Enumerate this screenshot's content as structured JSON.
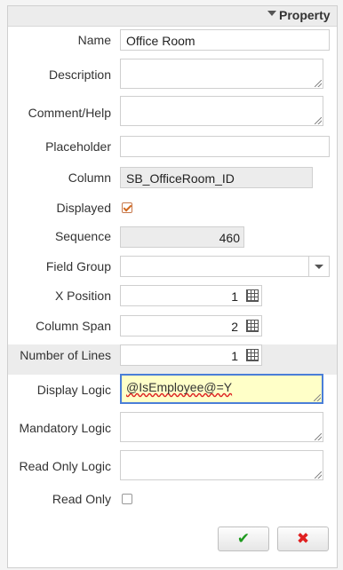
{
  "header": {
    "title": "Property"
  },
  "fields": {
    "name": {
      "label": "Name",
      "value": "Office Room"
    },
    "description": {
      "label": "Description",
      "value": ""
    },
    "comment_help": {
      "label": "Comment/Help",
      "value": ""
    },
    "placeholder": {
      "label": "Placeholder",
      "value": ""
    },
    "column": {
      "label": "Column",
      "value": "SB_OfficeRoom_ID"
    },
    "displayed": {
      "label": "Displayed",
      "checked": true
    },
    "sequence": {
      "label": "Sequence",
      "value": "460"
    },
    "field_group": {
      "label": "Field Group",
      "value": ""
    },
    "x_position": {
      "label": "X Position",
      "value": "1"
    },
    "column_span": {
      "label": "Column Span",
      "value": "2"
    },
    "number_of_lines": {
      "label": "Number of Lines",
      "value": "1"
    },
    "display_logic": {
      "label": "Display Logic",
      "value": "@IsEmployee@=Y"
    },
    "mandatory_logic": {
      "label": "Mandatory Logic",
      "value": ""
    },
    "read_only_logic": {
      "label": "Read Only Logic",
      "value": ""
    },
    "read_only": {
      "label": "Read Only",
      "checked": false
    }
  },
  "buttons": {
    "ok_glyph": "✔",
    "cancel_glyph": "✖",
    "ok_color": "#1e9a1e",
    "cancel_color": "#e02020"
  },
  "icons": [
    "collapse-arrow-icon",
    "calendar-grid-icon",
    "chevron-down-icon",
    "checkmark-icon",
    "cross-icon"
  ]
}
